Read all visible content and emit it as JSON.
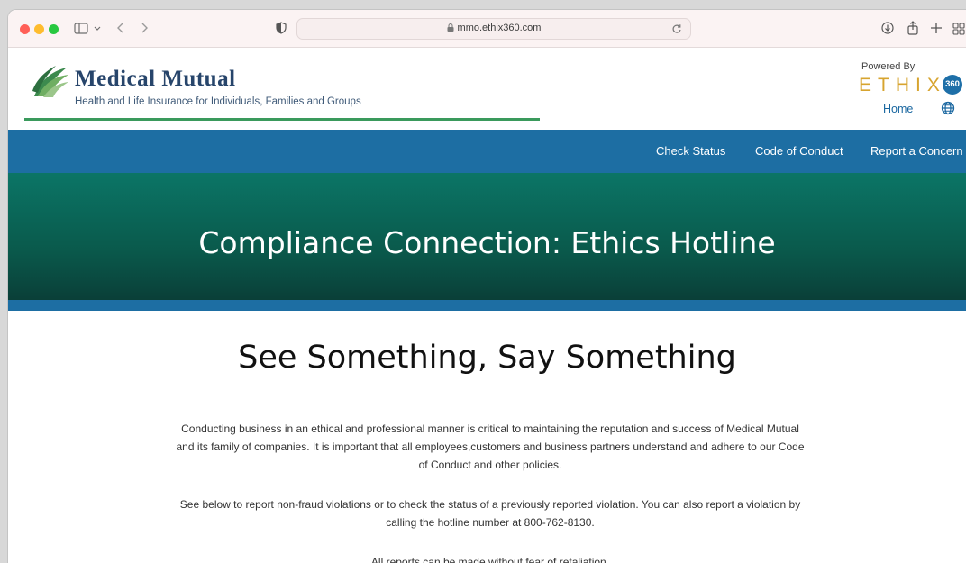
{
  "browser": {
    "url": "mmo.ethix360.com"
  },
  "header": {
    "brand_name": "Medical Mutual",
    "tagline": "Health and Life Insurance for Individuals, Families and Groups",
    "powered_by": "Powered By",
    "ethix_text": "ETHIX",
    "ethix_badge": "360",
    "home_label": "Home"
  },
  "nav": {
    "items": [
      {
        "label": "Check Status"
      },
      {
        "label": "Code of Conduct"
      },
      {
        "label": "Report a Concern"
      }
    ]
  },
  "hero": {
    "title": "Compliance Connection: Ethics Hotline"
  },
  "main": {
    "headline": "See Something, Say Something",
    "paragraph_1": "Conducting business in an ethical and professional manner is critical to maintaining the reputation and success of Medical Mutual and its family of companies. It is important that all employees,customers and business partners understand and adhere to our Code of Conduct and other policies.",
    "paragraph_2": "See below to report non-fraud violations or to check the status of a previously reported violation. You can also report a violation by calling the hotline number at 800-762-8130.",
    "paragraph_3": "All reports can be made without fear of retaliation."
  },
  "colors": {
    "nav_blue": "#1d6ea3",
    "hero_green": "#0b7566",
    "ethix_gold": "#d7a42f",
    "brand_navy": "#27456b",
    "rule_green": "#3a9a5c"
  }
}
